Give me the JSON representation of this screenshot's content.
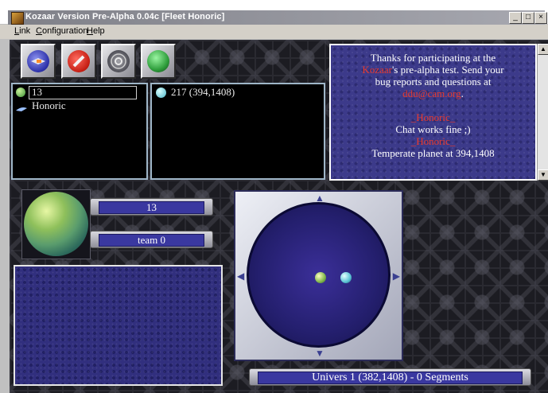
{
  "window": {
    "title": "Kozaar Version Pre-Alpha 0.04c [Fleet Honoric]",
    "minimize_glyph": "_",
    "maximize_glyph": "□",
    "close_glyph": "×"
  },
  "menu": {
    "items": [
      {
        "label": "Link"
      },
      {
        "label": "Configuration"
      },
      {
        "label": "Help"
      }
    ]
  },
  "toolbar": {
    "buttons": [
      {
        "icon": "fleet-icon"
      },
      {
        "icon": "no-entry-icon"
      },
      {
        "icon": "radar-icon"
      },
      {
        "icon": "globe-icon"
      }
    ]
  },
  "fleet_list": {
    "rows": [
      {
        "icon": "green-planet-icon",
        "text": "13"
      },
      {
        "icon": "ship-icon",
        "text": "Honoric"
      }
    ]
  },
  "planet_list": {
    "rows": [
      {
        "icon": "blue-planet-icon",
        "text": "217 (394,1408)"
      }
    ]
  },
  "message_box": {
    "line1": "Thanks for participating at the",
    "line2_red": "Kozaar",
    "line2_rest": "'s pre-alpha test. Send your",
    "line3": "bug reports and questions at",
    "line4_red": "ddu@cam.org",
    "line4_rest": ".",
    "sender1": "_Honoric_",
    "msg1": "Chat works fine ;)",
    "sender2": "_Honoric_",
    "msg2": "Temperate planet at 394,1408"
  },
  "planet_info": {
    "value1": "13",
    "value2": "team 0"
  },
  "status_bar": {
    "text": "Univers 1 (382,1408) - 0 Segments"
  },
  "colors": {
    "accent_red": "#e83a2e",
    "panel_blue": "#3a38a0",
    "border_light": "#9fb6c8"
  }
}
